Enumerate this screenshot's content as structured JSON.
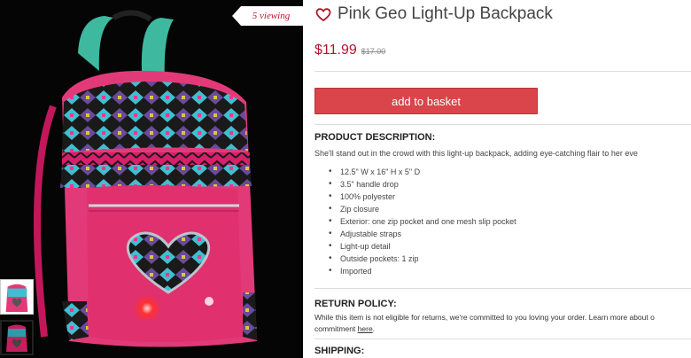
{
  "gallery": {
    "viewing_badge": "5 viewing",
    "main_image_icon": "backpack-photo",
    "thumbnails": [
      {
        "icon": "backpack-thumbnail-day"
      },
      {
        "icon": "backpack-thumbnail-lit"
      }
    ]
  },
  "product": {
    "favorite_icon": "heart-outline-icon",
    "title": "Pink Geo Light-Up Backpack",
    "price": "$11.99",
    "original_price": "$17.00",
    "add_button_label": "add to basket",
    "description_heading": "PRODUCT DESCRIPTION:",
    "description": "She'll stand out in the crowd with this light-up backpack, adding eye-catching flair to her eve",
    "features": [
      "12.5\" W x 16\" H x 5\" D",
      "3.5\" handle drop",
      "100% polyester",
      "Zip closure",
      "Exterior: one zip pocket and one mesh slip pocket",
      "Adjustable straps",
      "Light-up detail",
      "Outside pockets: 1 zip",
      "Imported"
    ],
    "return_heading": "RETURN POLICY:",
    "return_text": "While this item is not eligible for returns, we're committed to you loving your order. Learn more about o",
    "return_text_line2": "commitment ",
    "return_link": "here",
    "return_tail": ".",
    "shipping_heading": "SHIPPING:"
  },
  "colors": {
    "accent_price": "#b3142b",
    "button": "#d9454a",
    "badge_text": "#c0142b"
  }
}
